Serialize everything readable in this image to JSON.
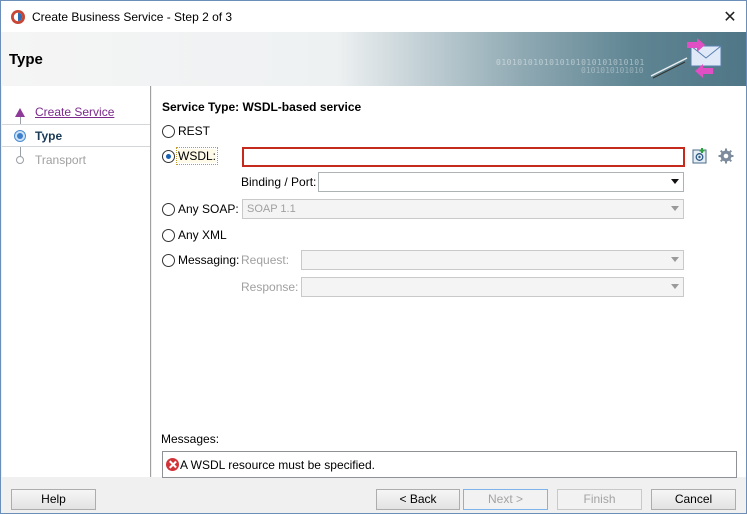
{
  "window": {
    "title": "Create Business Service - Step 2 of 3",
    "close_glyph": "✕"
  },
  "header": {
    "title": "Type",
    "binary_text_1": "0101010101010101010101010101",
    "binary_text_2": "0101010101010"
  },
  "steps": [
    {
      "label": "Create Service",
      "state": "visited"
    },
    {
      "label": "Type",
      "state": "current"
    },
    {
      "label": "Transport",
      "state": "pending"
    }
  ],
  "content": {
    "service_type": "Service Type: WSDL-based service",
    "options": {
      "rest": {
        "label": "REST",
        "checked": false
      },
      "wsdl": {
        "label": "WSDL:",
        "checked": true,
        "value": ""
      },
      "any_soap": {
        "label": "Any SOAP:",
        "checked": false,
        "selected": "SOAP 1.1"
      },
      "any_xml": {
        "label": "Any XML",
        "checked": false
      },
      "messaging": {
        "label": "Messaging:",
        "checked": false
      }
    },
    "binding_port_label": "Binding / Port:",
    "binding_port_value": "",
    "request_label": "Request:",
    "request_value": "",
    "response_label": "Response:",
    "response_value": "",
    "messages_label": "Messages:",
    "message_text": "A WSDL resource must be specified."
  },
  "buttons": {
    "help": "Help",
    "back": "< Back",
    "next": "Next >",
    "finish": "Finish",
    "cancel": "Cancel"
  },
  "colors": {
    "error": "#c42b1c",
    "radio_selected": "#1a5fb4",
    "visited_link": "#7b2a8c"
  }
}
